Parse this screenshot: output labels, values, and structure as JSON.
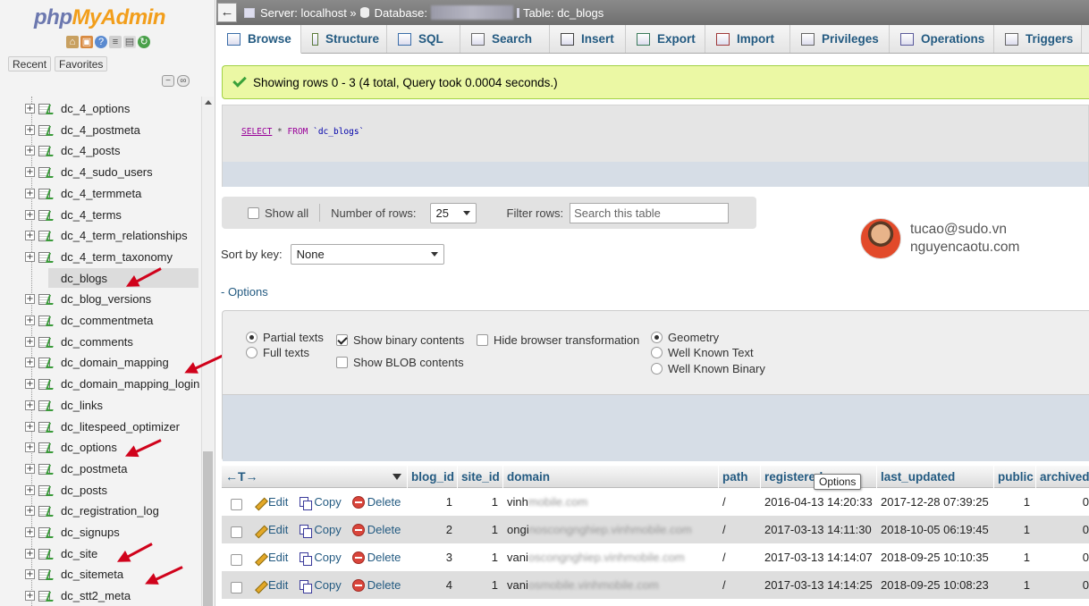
{
  "logo": {
    "php": "php",
    "myadmin": "MyAdmin"
  },
  "nav": {
    "recent": "Recent",
    "favorites": "Favorites",
    "tables": [
      "dc_4_options",
      "dc_4_postmeta",
      "dc_4_posts",
      "dc_4_sudo_users",
      "dc_4_termmeta",
      "dc_4_terms",
      "dc_4_term_relationships",
      "dc_4_term_taxonomy",
      "dc_blogs",
      "dc_blog_versions",
      "dc_commentmeta",
      "dc_comments",
      "dc_domain_mapping",
      "dc_domain_mapping_login",
      "dc_links",
      "dc_litespeed_optimizer",
      "dc_options",
      "dc_postmeta",
      "dc_posts",
      "dc_registration_log",
      "dc_signups",
      "dc_site",
      "dc_sitemeta",
      "dc_stt2_meta"
    ],
    "active_table": "dc_blogs"
  },
  "breadcrumb": {
    "server": "Server: localhost »",
    "database": "Database:",
    "table": "Table: dc_blogs"
  },
  "tabs": [
    {
      "label": "Browse",
      "icon": "browse-icon"
    },
    {
      "label": "Structure",
      "icon": "structure-icon"
    },
    {
      "label": "SQL",
      "icon": "sql-icon"
    },
    {
      "label": "Search",
      "icon": "search-icon"
    },
    {
      "label": "Insert",
      "icon": "insert-icon"
    },
    {
      "label": "Export",
      "icon": "export-icon"
    },
    {
      "label": "Import",
      "icon": "import-icon"
    },
    {
      "label": "Privileges",
      "icon": "privileges-icon"
    },
    {
      "label": "Operations",
      "icon": "operations-icon"
    },
    {
      "label": "Triggers",
      "icon": "triggers-icon"
    }
  ],
  "message": "Showing rows 0 - 3 (4 total, Query took 0.0004 seconds.)",
  "sql": {
    "select": "SELECT",
    "star": " * ",
    "from": "FROM",
    "table": " `dc_blogs`"
  },
  "controls": {
    "show_all": "Show all",
    "num_rows_label": "Number of rows:",
    "num_rows_value": "25",
    "filter_label": "Filter rows:",
    "filter_placeholder": "Search this table",
    "sort_label": "Sort by key:",
    "sort_value": "None",
    "options_link": "- Options"
  },
  "user": {
    "email": "tucao@sudo.vn",
    "site": "nguyencaotu.com"
  },
  "options": {
    "partial_texts": "Partial texts",
    "full_texts": "Full texts",
    "show_binary": "Show binary contents",
    "show_blob": "Show BLOB contents",
    "hide_transform": "Hide browser transformation",
    "geometry": "Geometry",
    "well_known_text": "Well Known Text",
    "well_known_binary": "Well Known Binary"
  },
  "table": {
    "headers": [
      "blog_id",
      "site_id",
      "domain",
      "path",
      "registered",
      "last_updated",
      "public",
      "archived"
    ],
    "tooltip": "Options",
    "actions": {
      "edit": "Edit",
      "copy": "Copy",
      "delete": "Delete"
    },
    "rows": [
      {
        "blog_id": "1",
        "site_id": "1",
        "domain_visible": "vinh",
        "domain_blurred": "mobile.com",
        "path": "/",
        "registered": "2016-04-13 14:20:33",
        "last_updated": "2017-12-28 07:39:25",
        "public": "1",
        "archived": "0"
      },
      {
        "blog_id": "2",
        "site_id": "1",
        "domain_visible": "ongi",
        "domain_blurred": "noscongnghiep.vinhmobile.com",
        "path": "/",
        "registered": "2017-03-13 14:11:30",
        "last_updated": "2018-10-05 06:19:45",
        "public": "1",
        "archived": "0"
      },
      {
        "blog_id": "3",
        "site_id": "1",
        "domain_visible": "vani",
        "domain_blurred": "oscongnghiep.vinhmobile.com",
        "path": "/",
        "registered": "2017-03-13 14:14:07",
        "last_updated": "2018-09-25 10:10:35",
        "public": "1",
        "archived": "0"
      },
      {
        "blog_id": "4",
        "site_id": "1",
        "domain_visible": "vani",
        "domain_blurred": "osmobile.vinhmobile.com",
        "path": "/",
        "registered": "2017-03-13 14:14:25",
        "last_updated": "2018-09-25 10:08:23",
        "public": "1",
        "archived": "0"
      }
    ]
  }
}
